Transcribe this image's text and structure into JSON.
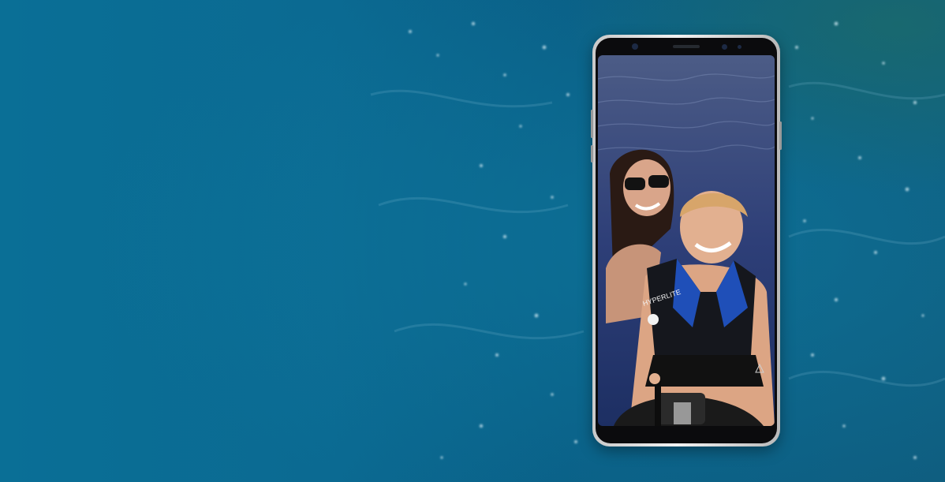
{
  "hero": {
    "background": {
      "left_color": "#0a6f96",
      "right_color": "#0d5f86"
    },
    "phone": {
      "frame_color": "#d9d9d9",
      "screen_content": "selfie-photo"
    },
    "photo": {
      "vest_text": "HYPERLITE"
    }
  }
}
